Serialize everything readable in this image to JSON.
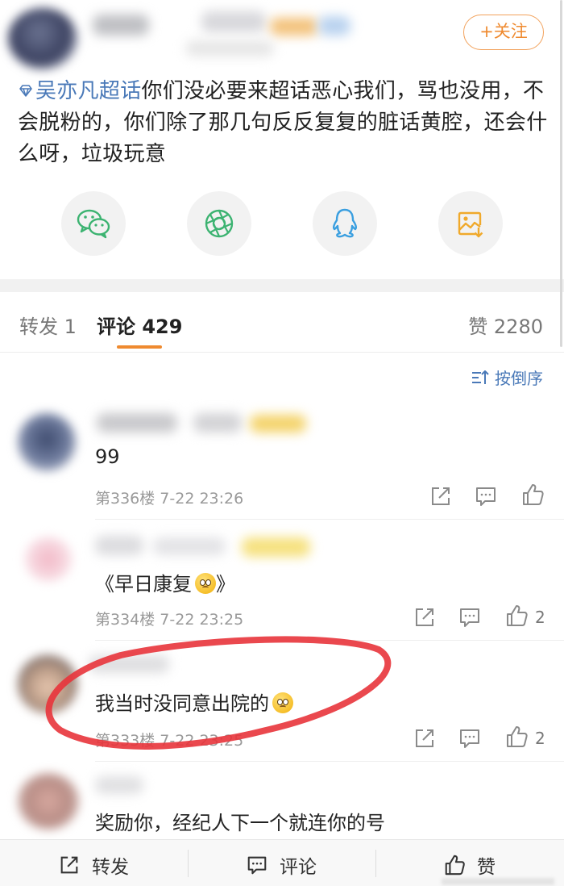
{
  "post": {
    "follow_label": "+关注",
    "topic_tag": "吴亦凡超话",
    "text": "你们没必要来超话恶心我们，骂也没用，不会脱粉的，你们除了那几句反反复复的脏话黄腔，还会什么呀，垃圾玩意",
    "share_icons": [
      "wechat-icon",
      "moments-icon",
      "qq-icon",
      "save-image-icon"
    ]
  },
  "tabs": {
    "repost": "转发 1",
    "comment": "评论 429",
    "like": "赞 2280"
  },
  "sort_label": "按倒序",
  "comments": [
    {
      "text": "99",
      "meta": "第336楼  7-22 23:26",
      "likes": ""
    },
    {
      "text": "《早日康复",
      "text_end": "》",
      "meta": "第334楼  7-22 23:25",
      "likes": "2"
    },
    {
      "text": "我当时没同意出院的",
      "meta": "第333楼  7-22 23:25",
      "likes": "2"
    },
    {
      "text": "奖励你，经纪人下一个就连你的号",
      "meta": "",
      "likes": ""
    }
  ],
  "bottom_bar": {
    "repost": "转发",
    "comment": "评论",
    "like": "赞"
  },
  "colors": {
    "accent": "#ef8a2f",
    "link": "#4a79b8",
    "annotation_red": "#e8343b"
  }
}
